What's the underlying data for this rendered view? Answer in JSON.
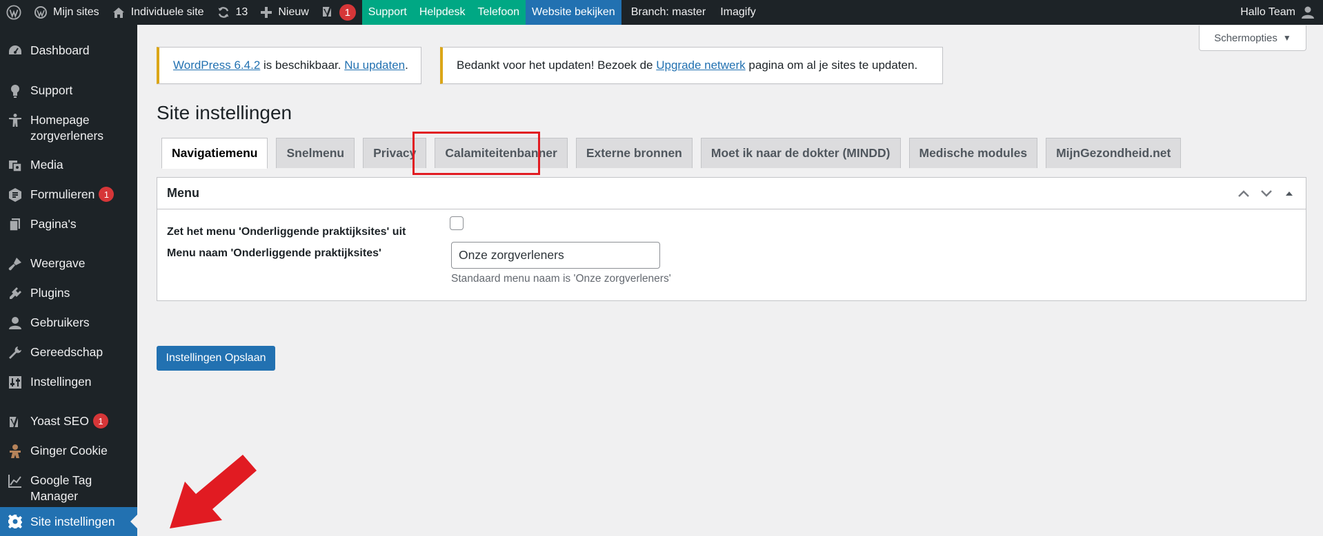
{
  "adminbar": {
    "my_sites": "Mijn sites",
    "site": "Individuele site",
    "updates_count": "13",
    "new": "Nieuw",
    "yoast_badge": "1",
    "support": "Support",
    "helpdesk": "Helpdesk",
    "telefoon": "Telefoon",
    "view_site": "Website bekijken",
    "branch": "Branch: master",
    "imagify": "Imagify",
    "greeting": "Hallo Team",
    "accent_green": "#00a884",
    "accent_blue": "#2271b1"
  },
  "sidebar": {
    "items": [
      {
        "label": "Dashboard",
        "icon": "dashboard-icon"
      },
      {
        "label": "Support",
        "icon": "lightbulb-icon"
      },
      {
        "label": "Homepage zorgverleners",
        "icon": "universal-access-icon"
      },
      {
        "label": "Media",
        "icon": "media-icon"
      },
      {
        "label": "Formulieren",
        "icon": "forms-icon",
        "badge": "1"
      },
      {
        "label": "Pagina's",
        "icon": "pages-icon"
      },
      {
        "label": "Weergave",
        "icon": "appearance-icon"
      },
      {
        "label": "Plugins",
        "icon": "plugins-icon"
      },
      {
        "label": "Gebruikers",
        "icon": "users-icon"
      },
      {
        "label": "Gereedschap",
        "icon": "tools-icon"
      },
      {
        "label": "Instellingen",
        "icon": "settings-icon"
      },
      {
        "label": "Yoast SEO",
        "icon": "yoast-icon",
        "badge": "1"
      },
      {
        "label": "Ginger Cookie",
        "icon": "gingerbread-icon"
      },
      {
        "label": "Google Tag Manager",
        "icon": "chart-line-icon"
      },
      {
        "label": "Site instellingen",
        "icon": "gear-icon",
        "current": true
      }
    ]
  },
  "screen_options": "Schermopties",
  "notices": {
    "update": {
      "link1": "WordPress 6.4.2",
      "text": " is beschikbaar. ",
      "link2": "Nu updaten",
      "end": "."
    },
    "network": {
      "before": "Bedankt voor het updaten! Bezoek de ",
      "link": "Upgrade netwerk",
      "after": " pagina om al je sites te updaten."
    }
  },
  "page_title": "Site instellingen",
  "tabs": [
    {
      "label": "Navigatiemenu",
      "active": true
    },
    {
      "label": "Snelmenu"
    },
    {
      "label": "Privacy"
    },
    {
      "label": "Calamiteitenbanner",
      "highlighted": true
    },
    {
      "label": "Externe bronnen"
    },
    {
      "label": "Moet ik naar de dokter (MINDD)"
    },
    {
      "label": "Medische modules"
    },
    {
      "label": "MijnGezondheid.net"
    }
  ],
  "postbox": {
    "title": "Menu",
    "fields": {
      "toggle_label": "Zet het menu 'Onderliggende praktijksites' uit",
      "toggle_checked": false,
      "name_label": "Menu naam 'Onderliggende praktijksites'",
      "name_value": "Onze zorgverleners",
      "name_help": "Standaard menu naam is 'Onze zorgverleners'"
    }
  },
  "save_button": "Instellingen Opslaan",
  "annotation": {
    "highlight_color": "#e11b22"
  }
}
